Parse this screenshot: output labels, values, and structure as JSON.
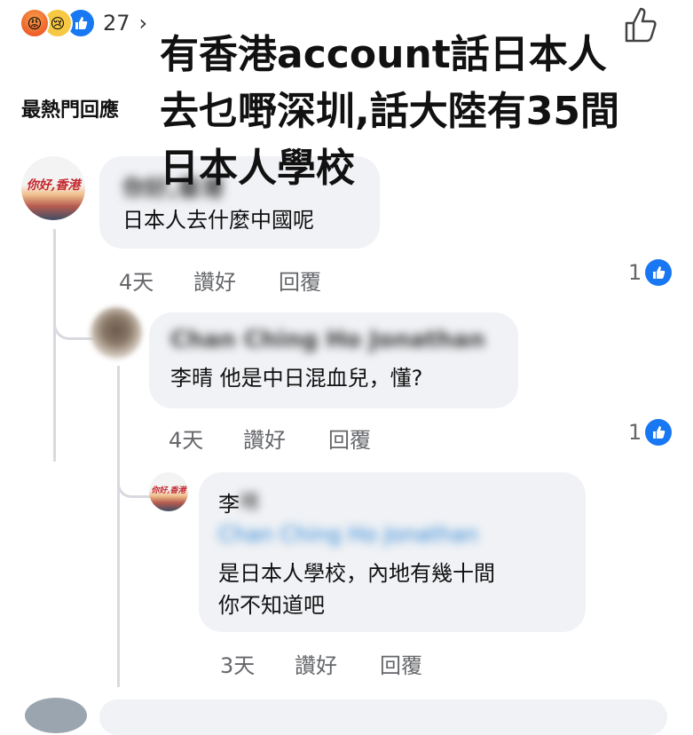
{
  "reactions": {
    "icons": [
      "angry-icon",
      "sad-icon",
      "like-icon"
    ],
    "count": "27",
    "chevron": "›"
  },
  "overlay": {
    "text": "有香港account話日本人\n去乜嘢深圳,話大陸有35間\n日本人學校"
  },
  "section_label": "最熱門回應",
  "comments": [
    {
      "author": "你好,香港",
      "text": "日本人去什麼中國呢",
      "time": "4天",
      "like_label": "讚好",
      "reply_label": "回覆",
      "likes": "1"
    },
    {
      "author": "Chan Ching Ho Jonathan",
      "text": "李晴 他是中日混血兒，懂?",
      "time": "4天",
      "like_label": "讚好",
      "reply_label": "回覆",
      "likes": "1"
    },
    {
      "author": "李",
      "author_hidden": "晴",
      "mention": "Chan Ching Ho Jonathan",
      "text": "是日本人學校，內地有幾十間\n你不知道吧",
      "time": "3天",
      "like_label": "讚好",
      "reply_label": "回覆"
    }
  ],
  "avatar_text": "你好,香港",
  "colors": {
    "bubble": "#f0f2f5",
    "facebook_blue": "#1877f2",
    "meta_grey": "#65676b"
  }
}
